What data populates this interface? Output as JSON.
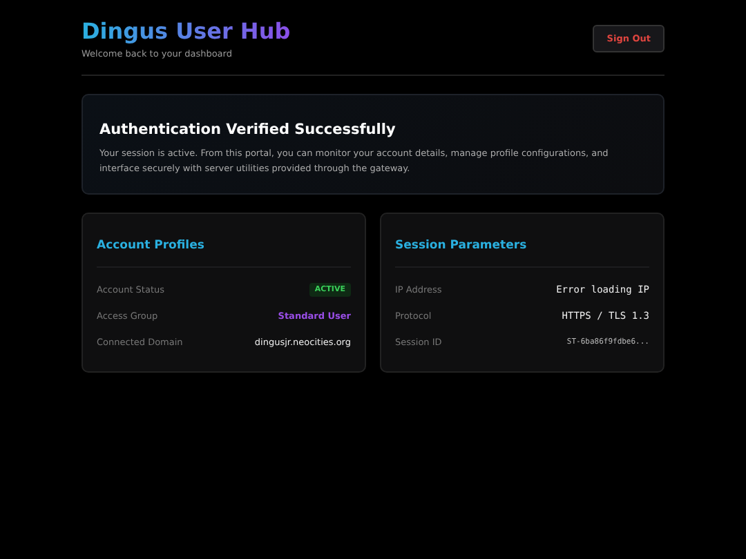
{
  "header": {
    "title": "Dingus User Hub",
    "subtitle": "Welcome back to your dashboard",
    "sign_out": "Sign Out"
  },
  "notice": {
    "title": "Authentication Verified Successfully",
    "body": "Your session is active. From this portal, you can monitor your account details, manage profile configurations, and interface securely with server utilities provided through the gateway."
  },
  "cards": [
    {
      "title": "Account Profiles",
      "rows": [
        {
          "label": "Account Status",
          "value": "ACTIVE",
          "kind": "badge"
        },
        {
          "label": "Access Group",
          "value": "Standard User",
          "kind": "accent"
        },
        {
          "label": "Connected Domain",
          "value": "dingusjr.neocities.org",
          "kind": "plain"
        }
      ]
    },
    {
      "title": "Session Parameters",
      "rows": [
        {
          "label": "IP Address",
          "value": "Error loading IP",
          "kind": "mono"
        },
        {
          "label": "Protocol",
          "value": "HTTPS / TLS 1.3",
          "kind": "mono"
        },
        {
          "label": "Session ID",
          "value": "ST-6ba86f9fdbe6...",
          "kind": "mono-small"
        }
      ]
    }
  ]
}
